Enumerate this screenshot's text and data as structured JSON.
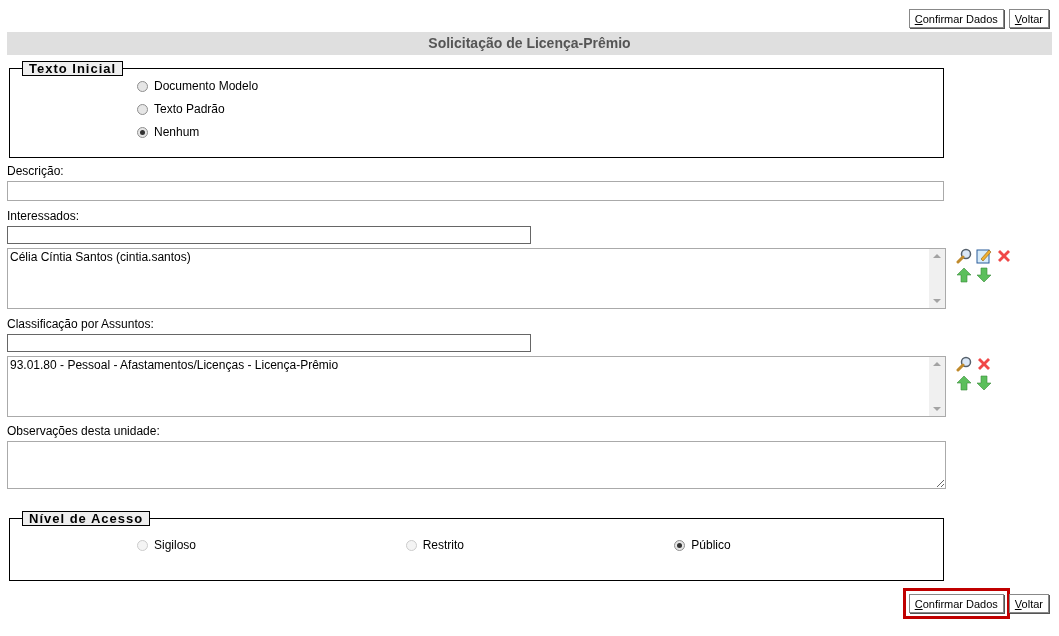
{
  "top_buttons": [
    {
      "label": "Confirmar Dados",
      "highlighted": false
    },
    {
      "label": "Voltar",
      "highlighted": false
    }
  ],
  "title": "Solicitação de Licença-Prêmio",
  "texto_inicial": {
    "legend": "Texto Inicial",
    "options": [
      {
        "label": "Documento Modelo",
        "selected": false
      },
      {
        "label": "Texto Padrão",
        "selected": false
      },
      {
        "label": "Nenhum",
        "selected": true
      }
    ]
  },
  "descricao": {
    "label": "Descrição:"
  },
  "interessados": {
    "label": "Interessados:",
    "items": [
      "Célia Cíntia Santos (cintia.santos)"
    ],
    "actions": [
      {
        "kind": "search"
      },
      {
        "kind": "edit"
      },
      {
        "kind": "remove"
      },
      {
        "kind": "up"
      },
      {
        "kind": "down"
      }
    ]
  },
  "classificacao": {
    "label": "Classificação por Assuntos:",
    "items": [
      "93.01.80 - Pessoal - Afastamentos/Licenças - Licença-Prêmio"
    ],
    "actions": [
      {
        "kind": "search"
      },
      {
        "kind": "remove"
      },
      {
        "kind": "up"
      },
      {
        "kind": "down"
      }
    ]
  },
  "observacoes": {
    "label": "Observações desta unidade:"
  },
  "nivel_acesso": {
    "legend": "Nível de Acesso",
    "options": [
      {
        "label": "Sigiloso",
        "selected": false,
        "disabled": true
      },
      {
        "label": "Restrito",
        "selected": false,
        "disabled": true
      },
      {
        "label": "Público",
        "selected": true,
        "disabled": false
      }
    ]
  },
  "bottom_buttons": [
    {
      "label": "Confirmar Dados",
      "highlighted": true
    },
    {
      "label": "Voltar",
      "highlighted": false
    }
  ]
}
